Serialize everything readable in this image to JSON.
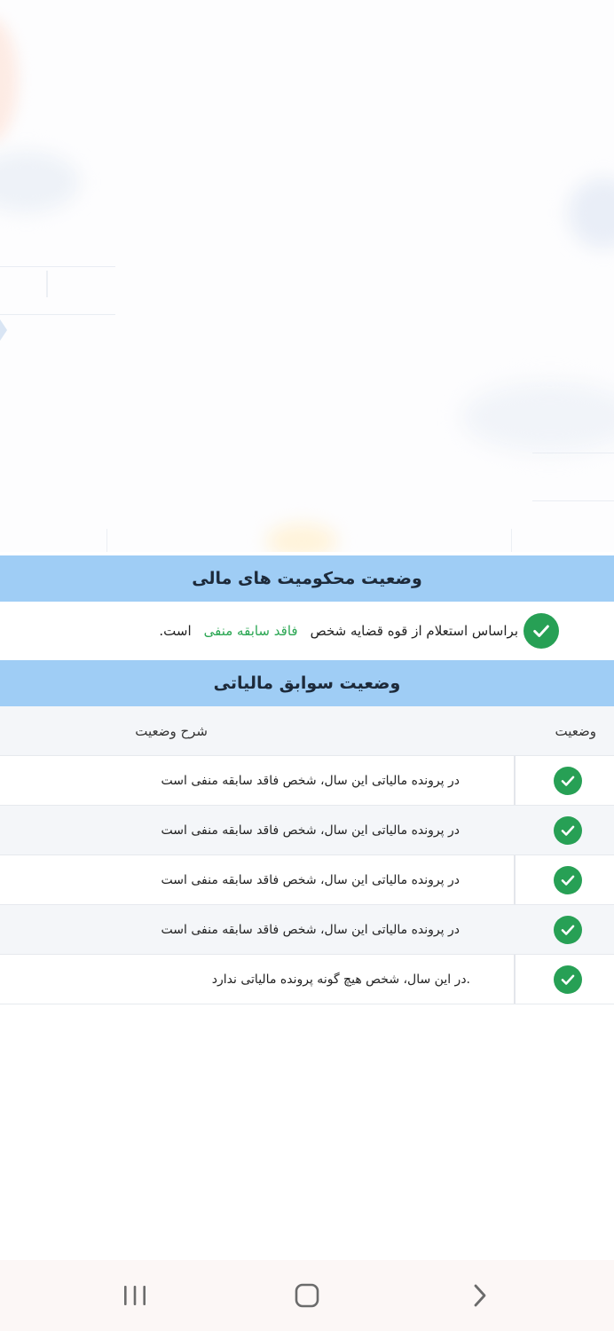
{
  "financial_convictions": {
    "title": "وضعیت محکومیت های مالی",
    "text_before": "براساس استعلام از قوه قضایه شخص",
    "highlight": "فاقد سابقه منفی",
    "text_after": "است.",
    "highlight_color": "#2aa652"
  },
  "tax_records": {
    "title": "وضعیت سوابق مالیاتی",
    "columns": {
      "status": "وضعیت",
      "description": "شرح وضعیت"
    },
    "rows": [
      {
        "status_icon": "check-circle-icon",
        "description": "در پرونده مالیاتی این سال، شخص فاقد سابقه منفی است"
      },
      {
        "status_icon": "check-circle-icon",
        "description": "در پرونده مالیاتی این سال، شخص فاقد سابقه منفی است"
      },
      {
        "status_icon": "check-circle-icon",
        "description": "در پرونده مالیاتی این سال، شخص فاقد سابقه منفی است"
      },
      {
        "status_icon": "check-circle-icon",
        "description": "در پرونده مالیاتی این سال، شخص فاقد سابقه منفی است"
      },
      {
        "status_icon": "check-circle-icon",
        "description": ".در این سال، شخص هیچ گونه پرونده مالیاتی ندارد"
      }
    ]
  },
  "colors": {
    "header_bg": "#9fcdf5",
    "check_green": "#27a055",
    "row_alt_bg": "#f4f6f9"
  },
  "system_nav": {
    "recent_icon": "recent-apps-icon",
    "home_icon": "home-icon",
    "back_icon": "back-chevron-icon"
  }
}
